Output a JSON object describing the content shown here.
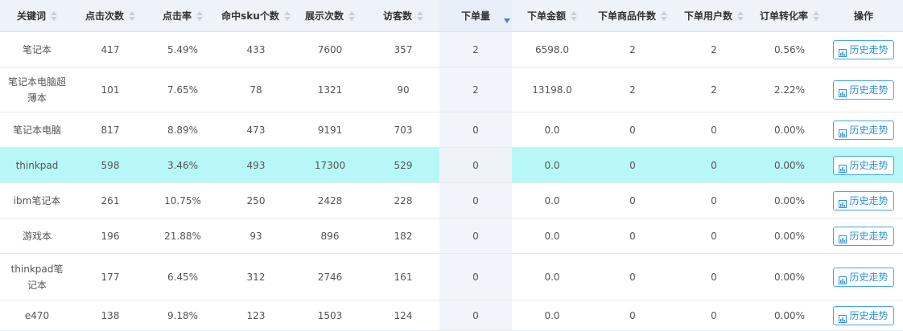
{
  "header": {
    "columns": [
      "关键词",
      "点击次数",
      "点击率",
      "命中sku个数",
      "展示次数",
      "访客数",
      "下单量",
      "下单金额",
      "下单商品件数",
      "下单用户数",
      "订单转化率",
      "操作"
    ]
  },
  "colors": {
    "highlight_row": "#b8f7f7",
    "button_border": "#44a6ec",
    "button_text": "#2f93e0",
    "header_bg": "#eef3f9",
    "sorted_column_bg": "#f1f5fb"
  },
  "sorted_column": "下单量",
  "sort_direction": "descending",
  "action_label": "历史走势",
  "action_icon": "chart-icon",
  "rows": [
    [
      "笔记本",
      "417",
      "5.49%",
      "433",
      "7600",
      "357",
      "2",
      "6598.0",
      "2",
      "2",
      "0.56%"
    ],
    [
      "笔记本电脑超薄本",
      "101",
      "7.65%",
      "78",
      "1321",
      "90",
      "2",
      "13198.0",
      "2",
      "2",
      "2.22%"
    ],
    [
      "笔记本电脑",
      "817",
      "8.89%",
      "473",
      "9191",
      "703",
      "0",
      "0.0",
      "0",
      "0",
      "0.00%"
    ],
    [
      "thinkpad",
      "598",
      "3.46%",
      "493",
      "17300",
      "529",
      "0",
      "0.0",
      "0",
      "0",
      "0.00%"
    ],
    [
      "ibm笔记本",
      "261",
      "10.75%",
      "250",
      "2428",
      "228",
      "0",
      "0.0",
      "0",
      "0",
      "0.00%"
    ],
    [
      "游戏本",
      "196",
      "21.88%",
      "93",
      "896",
      "182",
      "0",
      "0.0",
      "0",
      "0",
      "0.00%"
    ],
    [
      "thinkpad笔记本",
      "177",
      "6.45%",
      "312",
      "2746",
      "161",
      "0",
      "0.0",
      "0",
      "0",
      "0.00%"
    ],
    [
      "e470",
      "138",
      "9.18%",
      "123",
      "1503",
      "124",
      "0",
      "0.0",
      "0",
      "0",
      "0.00%"
    ]
  ],
  "highlighted_row": 3
}
